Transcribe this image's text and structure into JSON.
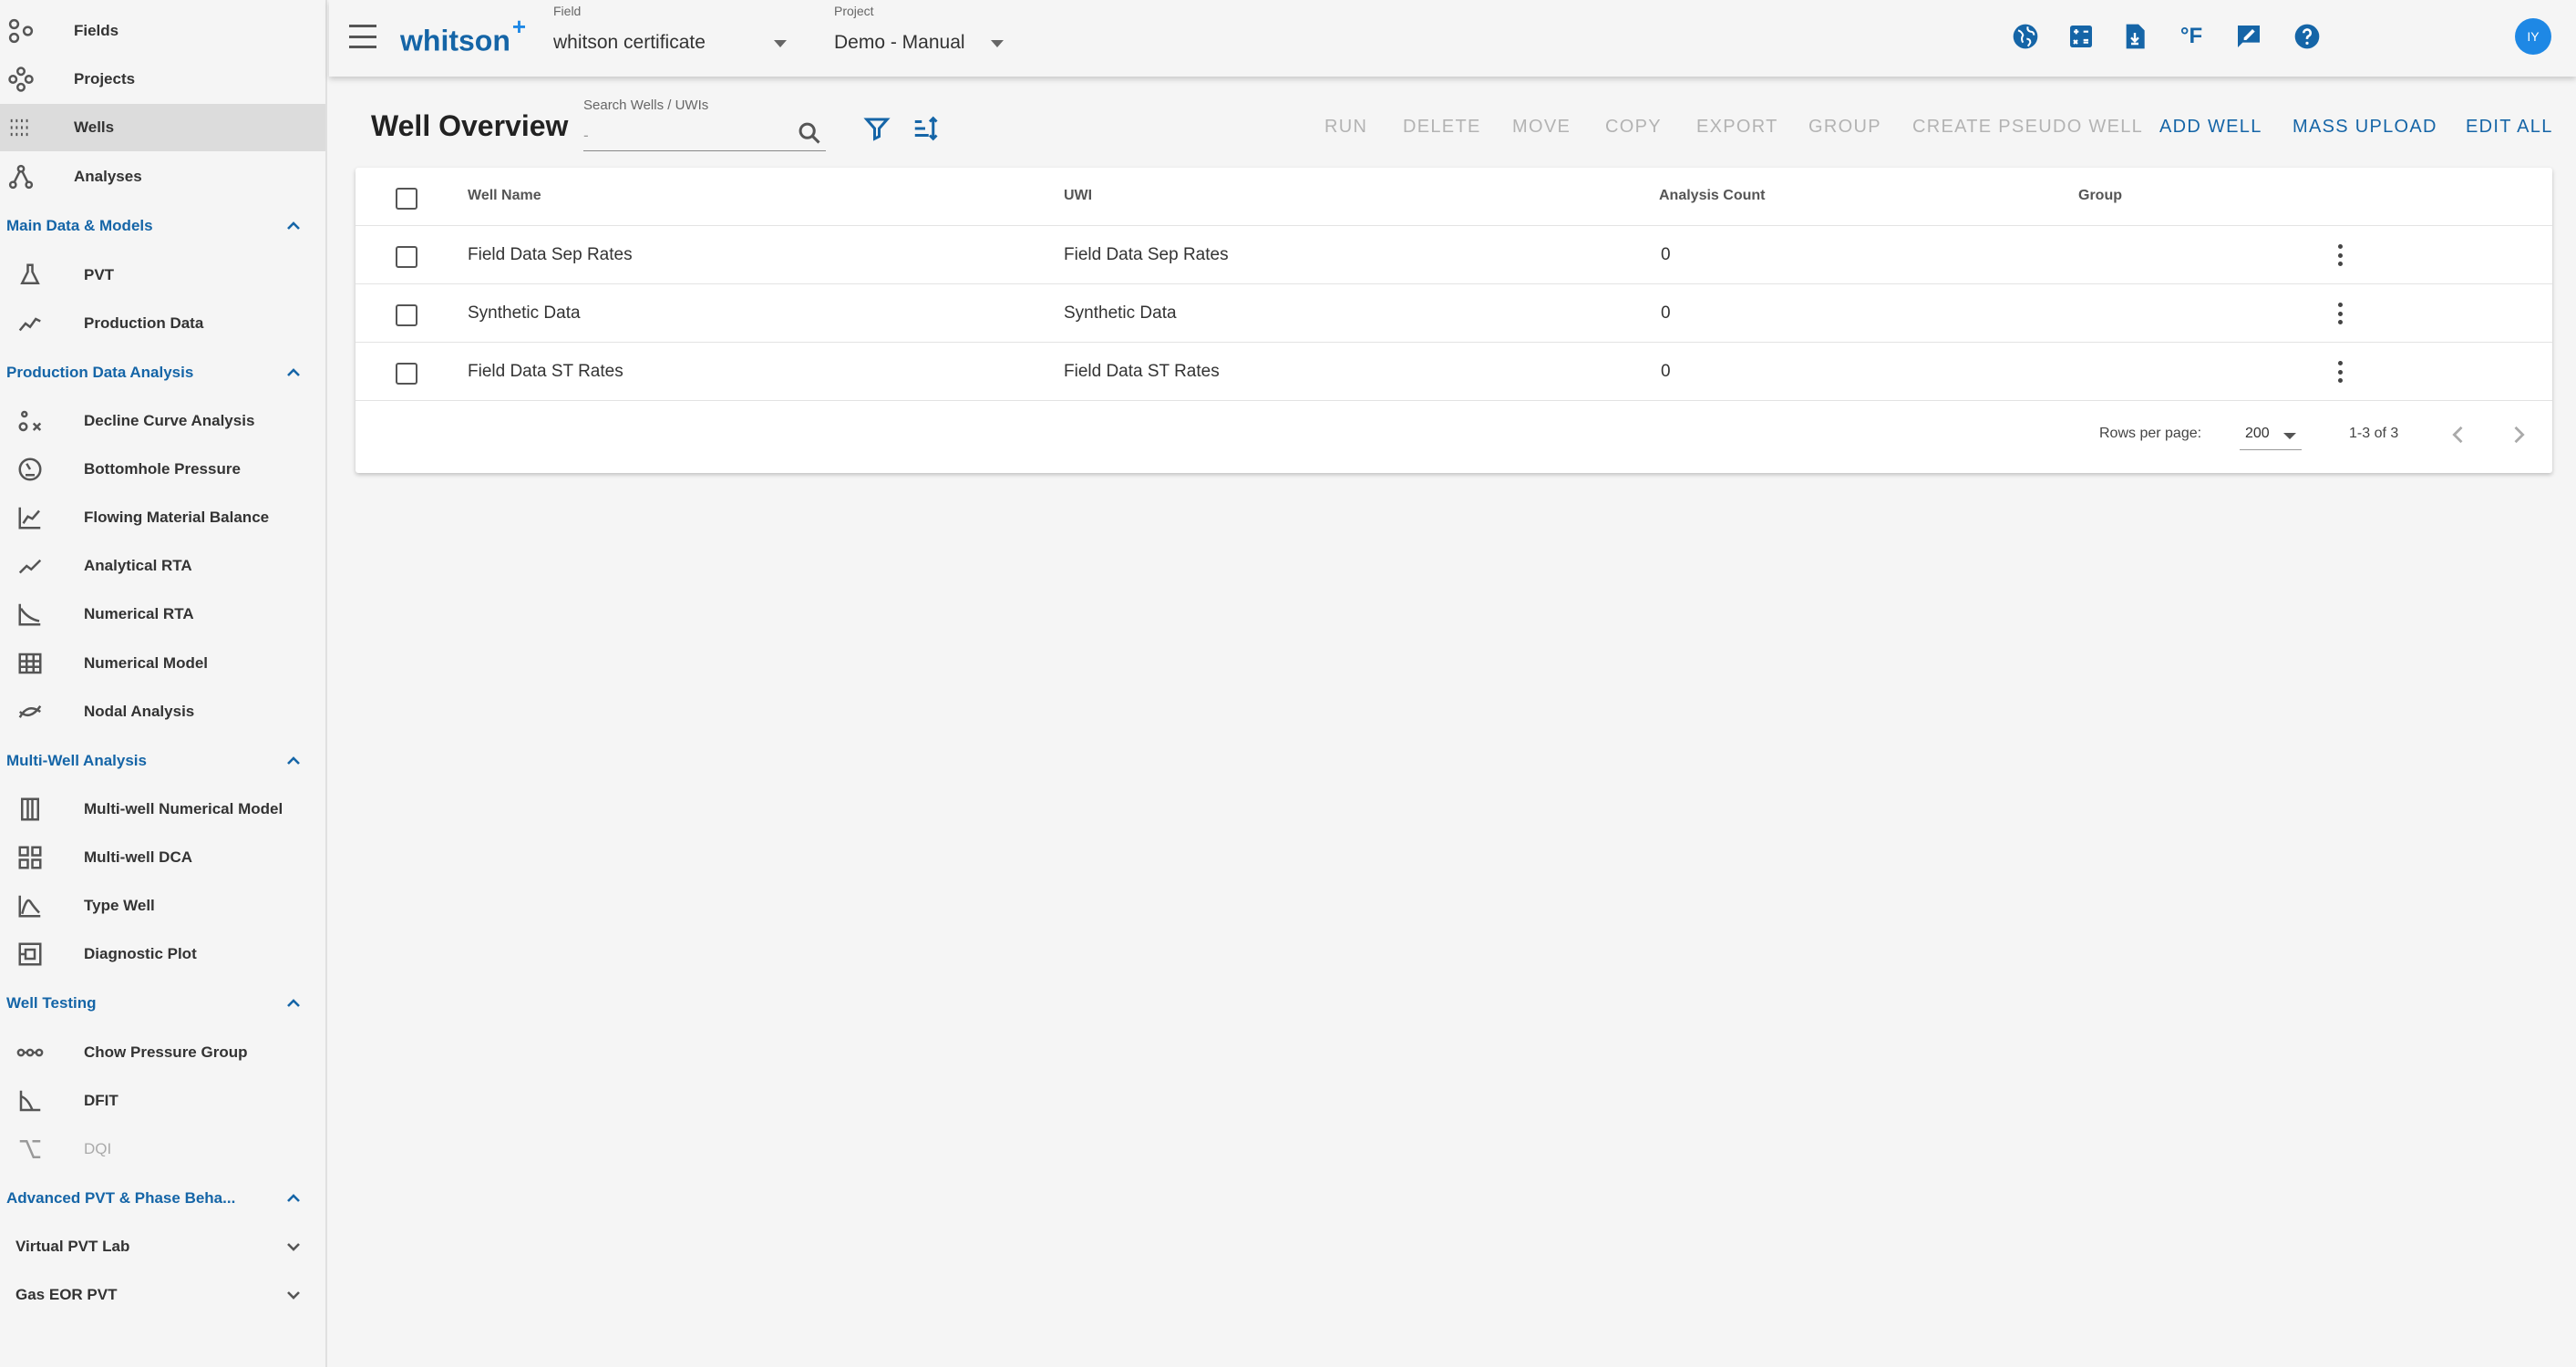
{
  "sidebar": {
    "top_items": [
      {
        "label": "Fields",
        "icon": "fields-icon"
      },
      {
        "label": "Projects",
        "icon": "projects-icon"
      },
      {
        "label": "Wells",
        "icon": "wells-icon",
        "active": true
      },
      {
        "label": "Analyses",
        "icon": "analyses-icon"
      }
    ],
    "sections": [
      {
        "title": "Main Data & Models",
        "expanded": true,
        "items": [
          {
            "label": "PVT",
            "icon": "flask-icon"
          },
          {
            "label": "Production Data",
            "icon": "line-chart-icon"
          }
        ]
      },
      {
        "title": "Production Data Analysis",
        "expanded": true,
        "items": [
          {
            "label": "Decline Curve Analysis",
            "icon": "decline-curve-icon"
          },
          {
            "label": "Bottomhole Pressure",
            "icon": "gauge-icon"
          },
          {
            "label": "Flowing Material Balance",
            "icon": "material-balance-icon"
          },
          {
            "label": "Analytical RTA",
            "icon": "trend-icon"
          },
          {
            "label": "Numerical RTA",
            "icon": "numerical-rta-icon"
          },
          {
            "label": "Numerical Model",
            "icon": "grid-model-icon"
          },
          {
            "label": "Nodal Analysis",
            "icon": "nodal-icon"
          }
        ]
      },
      {
        "title": "Multi-Well Analysis",
        "expanded": true,
        "items": [
          {
            "label": "Multi-well Numerical Model",
            "icon": "columns-icon"
          },
          {
            "label": "Multi-well DCA",
            "icon": "dashboard-grid-icon"
          },
          {
            "label": "Type Well",
            "icon": "type-well-icon"
          },
          {
            "label": "Diagnostic Plot",
            "icon": "diagnostic-plot-icon"
          }
        ]
      },
      {
        "title": "Well Testing",
        "expanded": true,
        "items": [
          {
            "label": "Chow Pressure Group",
            "icon": "chain-dots-icon"
          },
          {
            "label": "DFIT",
            "icon": "dfit-curve-icon"
          },
          {
            "label": "DQI",
            "icon": "dqi-icon",
            "disabled": true
          }
        ]
      },
      {
        "title": "Advanced PVT & Phase Beha...",
        "expanded": true,
        "items": []
      }
    ],
    "collapsed_groups": [
      {
        "title": "Virtual PVT Lab"
      },
      {
        "title": "Gas EOR PVT"
      }
    ]
  },
  "topbar": {
    "logo": "whitson",
    "logo_plus": "+",
    "field_caption": "Field",
    "field_value": "whitson certificate",
    "project_caption": "Project",
    "project_value": "Demo - Manual",
    "icons": [
      "globe-icon",
      "calculator-icon",
      "download-file-icon",
      "fahrenheit-icon",
      "feedback-icon",
      "help-icon"
    ],
    "fahrenheit_label": "°F",
    "avatar_initials": "IY"
  },
  "main": {
    "title": "Well Overview",
    "search": {
      "caption": "Search Wells / UWIs",
      "placeholder": "-"
    },
    "actions": [
      {
        "label": "RUN",
        "enabled": false
      },
      {
        "label": "DELETE",
        "enabled": false
      },
      {
        "label": "MOVE",
        "enabled": false
      },
      {
        "label": "COPY",
        "enabled": false
      },
      {
        "label": "EXPORT",
        "enabled": false
      },
      {
        "label": "GROUP",
        "enabled": false
      },
      {
        "label": "CREATE PSEUDO WELL",
        "enabled": false
      },
      {
        "label": "ADD WELL",
        "enabled": true
      },
      {
        "label": "MASS UPLOAD",
        "enabled": true
      },
      {
        "label": "EDIT ALL",
        "enabled": true
      }
    ],
    "table": {
      "headers": [
        "Well Name",
        "UWI",
        "Analysis Count",
        "Group"
      ],
      "rows": [
        {
          "name": "Field Data Sep Rates",
          "uwi": "Field Data Sep Rates",
          "count": "0",
          "group": ""
        },
        {
          "name": "Synthetic Data",
          "uwi": "Synthetic Data",
          "count": "0",
          "group": ""
        },
        {
          "name": "Field Data ST Rates",
          "uwi": "Field Data ST Rates",
          "count": "0",
          "group": ""
        }
      ]
    },
    "pagination": {
      "rows_per_page_label": "Rows per page:",
      "rows_per_page": "200",
      "range": "1-3 of 3"
    }
  },
  "colors": {
    "accent": "#1565a7",
    "avatar": "#1e88e5",
    "disabled": "#b3b3b3"
  }
}
